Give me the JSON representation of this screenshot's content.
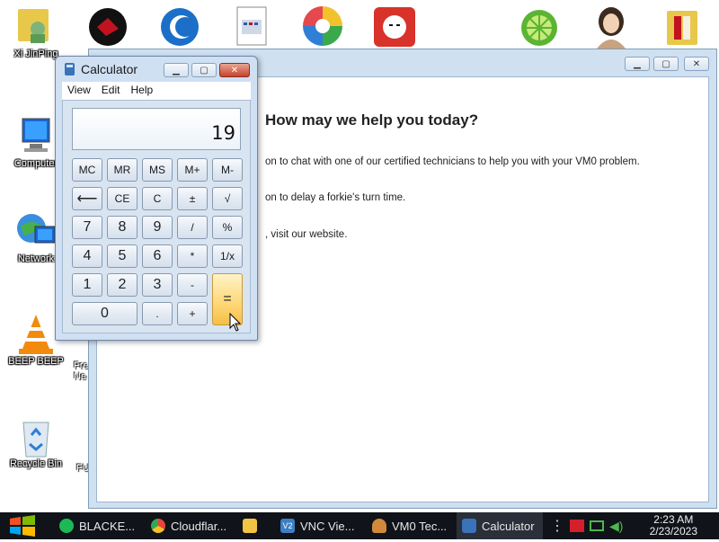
{
  "desktop": {
    "icons": [
      {
        "label": "Xi JinPing"
      },
      {
        "label": "Computer"
      },
      {
        "label": "Network"
      },
      {
        "label": "BEEP BEEP"
      },
      {
        "label": "Recycle Bin"
      }
    ],
    "partial_labels": [
      "Fre",
      "Ne",
      "FU"
    ]
  },
  "help_window": {
    "heading": "How may we help you today?",
    "lines": [
      "on to chat with one of our certified technicians to help you with your VM0 problem.",
      "on to delay a forkie's turn time.",
      ", visit our website."
    ]
  },
  "calculator": {
    "title": "Calculator",
    "menu": [
      "View",
      "Edit",
      "Help"
    ],
    "display": "19",
    "buttons": {
      "mc": "MC",
      "mr": "MR",
      "ms": "MS",
      "mplus": "M+",
      "mminus": "M-",
      "back": "⟵",
      "ce": "CE",
      "c": "C",
      "pm": "±",
      "sqrt": "√",
      "seven": "7",
      "eight": "8",
      "nine": "9",
      "div": "/",
      "pct": "%",
      "four": "4",
      "five": "5",
      "six": "6",
      "mul": "*",
      "recip": "1/x",
      "one": "1",
      "two": "2",
      "three": "3",
      "sub": "-",
      "eq": "=",
      "zero": "0",
      "dot": ".",
      "add": "+"
    }
  },
  "taskbar": {
    "tasks": [
      {
        "label": "BLACKE...",
        "icon": "spotify-icon",
        "color": "#1db954"
      },
      {
        "label": "Cloudflar...",
        "icon": "chrome-icon",
        "color": "#e8453c"
      },
      {
        "label": "",
        "icon": "folder-icon",
        "color": "#f3c343"
      },
      {
        "label": "VNC Vie...",
        "icon": "vnc-icon",
        "color": "#3c7fc4"
      },
      {
        "label": "VM0 Tec...",
        "icon": "technician-icon",
        "color": "#d08a3a"
      },
      {
        "label": "Calculator",
        "icon": "calculator-icon",
        "color": "#3a73b9"
      }
    ],
    "clock": {
      "time": "2:23 AM",
      "date": "2/23/2023"
    }
  }
}
